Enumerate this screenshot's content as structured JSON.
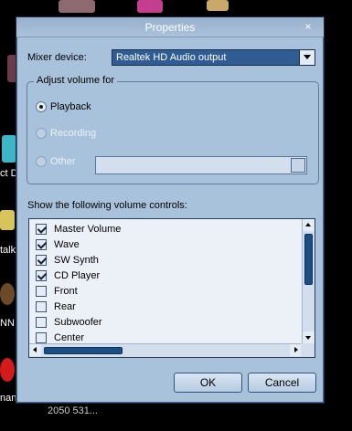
{
  "dialog": {
    "title": "Properties",
    "close_label": "×",
    "mixer_label": "Mixer device:",
    "mixer_value": "Realtek HD Audio output",
    "group_title": "Adjust volume for",
    "radios": [
      {
        "label": "Playback",
        "checked": true,
        "enabled": true
      },
      {
        "label": "Recording",
        "checked": false,
        "enabled": false
      },
      {
        "label": "Other",
        "checked": false,
        "enabled": false
      }
    ],
    "controls_label": "Show the following volume controls:",
    "controls": [
      {
        "label": "Master Volume",
        "checked": true
      },
      {
        "label": "Wave",
        "checked": true
      },
      {
        "label": "SW Synth",
        "checked": true
      },
      {
        "label": "CD Player",
        "checked": true
      },
      {
        "label": "Front",
        "checked": false
      },
      {
        "label": "Rear",
        "checked": false
      },
      {
        "label": "Subwoofer",
        "checked": false
      },
      {
        "label": "Center",
        "checked": false
      }
    ],
    "ok_label": "OK",
    "cancel_label": "Cancel"
  },
  "desktop": {
    "fragment_labels": [
      "ct D",
      "talk",
      "NN",
      "nan",
      "2050 531..."
    ]
  }
}
